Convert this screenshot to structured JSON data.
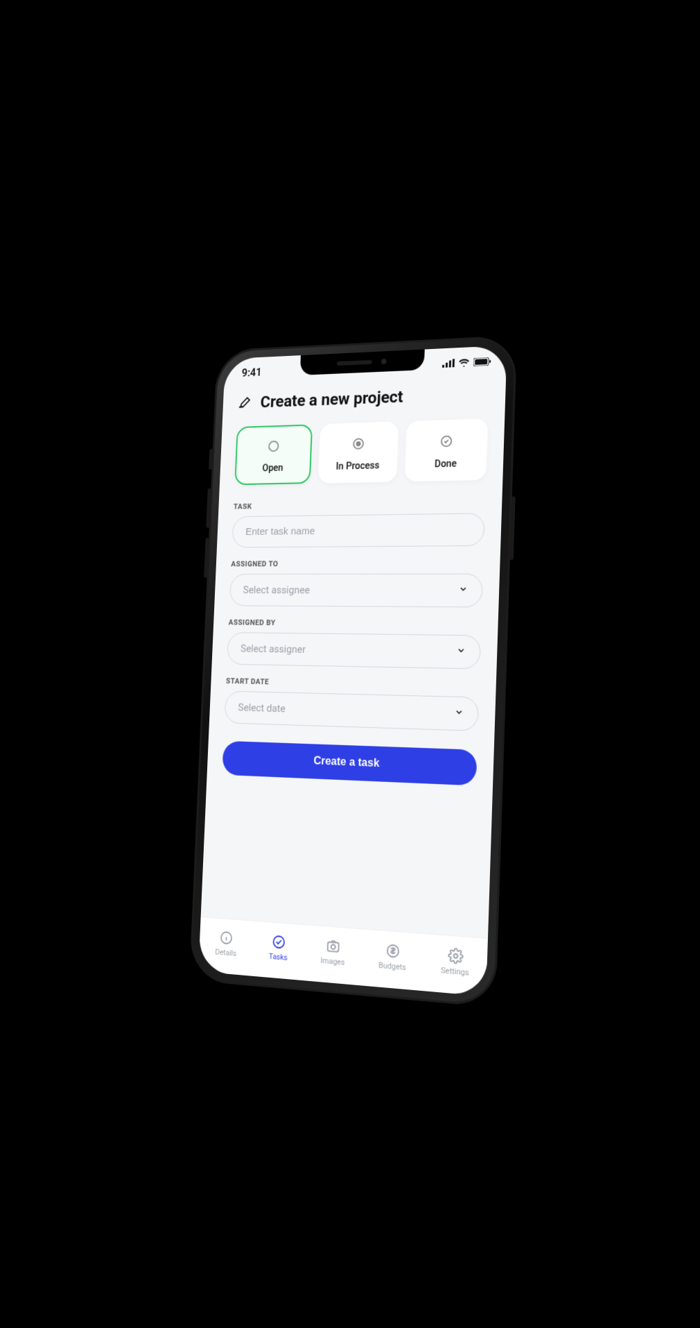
{
  "statusbar": {
    "time": "9:41"
  },
  "header": {
    "title": "Create a new project"
  },
  "taskStatus": {
    "options": [
      {
        "label": "Open",
        "active": true
      },
      {
        "label": "In Process",
        "active": false
      },
      {
        "label": "Done",
        "active": false
      }
    ]
  },
  "form": {
    "task": {
      "label": "TASK",
      "placeholder": "Enter task name"
    },
    "assignedTo": {
      "label": "ASSIGNED TO",
      "placeholder": "Select assignee"
    },
    "assignedBy": {
      "label": "ASSIGNED BY",
      "placeholder": "Select assigner"
    },
    "startDate": {
      "label": "START DATE",
      "placeholder": "Select date"
    },
    "submit": "Create a task"
  },
  "tabs": [
    {
      "label": "Details",
      "active": false
    },
    {
      "label": "Tasks",
      "active": true
    },
    {
      "label": "Images",
      "active": false
    },
    {
      "label": "Budgets",
      "active": false
    },
    {
      "label": "Settings",
      "active": false
    }
  ]
}
